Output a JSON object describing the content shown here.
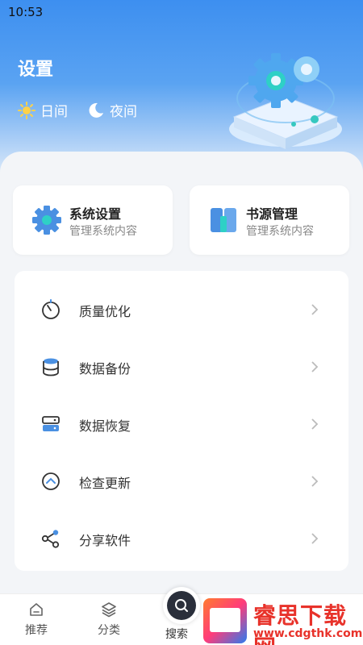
{
  "status_bar": {
    "time": "10:53"
  },
  "header": {
    "title": "设置",
    "modes": [
      {
        "label": "日间",
        "icon": "sun-icon"
      },
      {
        "label": "夜间",
        "icon": "moon-icon"
      }
    ]
  },
  "cards": [
    {
      "title": "系统设置",
      "subtitle": "管理系统内容",
      "icon": "gear-icon"
    },
    {
      "title": "书源管理",
      "subtitle": "管理系统内容",
      "icon": "book-icon"
    }
  ],
  "menu": [
    {
      "label": "质量优化",
      "icon": "timer-icon"
    },
    {
      "label": "数据备份",
      "icon": "database-icon"
    },
    {
      "label": "数据恢复",
      "icon": "server-icon"
    },
    {
      "label": "检查更新",
      "icon": "chevron-up-circle-icon"
    },
    {
      "label": "分享软件",
      "icon": "share-icon"
    }
  ],
  "bottom_nav": {
    "items": [
      {
        "label": "推荐",
        "icon": "home-icon"
      },
      {
        "label": "分类",
        "icon": "layers-icon"
      },
      {
        "label": "搜索",
        "icon": "search-icon"
      }
    ]
  },
  "watermark": {
    "text": "睿思下载网",
    "url": "www.cdgthk.com"
  },
  "colors": {
    "accent": "#3d8ff0",
    "icon_blue": "#4a90e2",
    "text_muted": "#888888"
  }
}
